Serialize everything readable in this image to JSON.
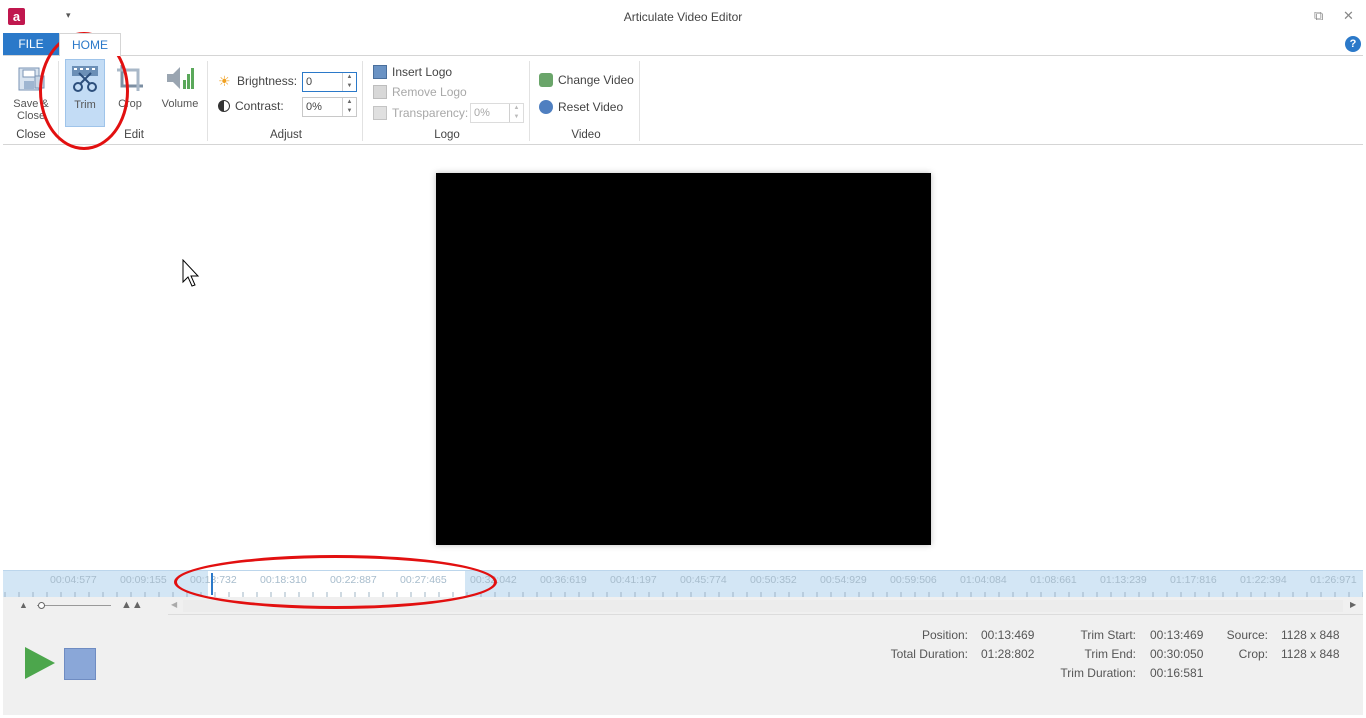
{
  "window": {
    "title": "Articulate Video Editor",
    "restore_glyph": "⧉",
    "close_glyph": "✕"
  },
  "app_icon_letter": "a",
  "qat_glyph": "▾",
  "ribbon": {
    "tabs": {
      "file": "FILE",
      "home": "HOME"
    },
    "help_glyph": "?",
    "close_group": {
      "label": "Close",
      "save_close_line1": "Save &",
      "save_close_line2": "Close"
    },
    "edit_group": {
      "label": "Edit",
      "trim": "Trim",
      "crop": "Crop",
      "volume": "Volume"
    },
    "adjust_group": {
      "label": "Adjust",
      "brightness_label": "Brightness:",
      "brightness_value": "0",
      "contrast_label": "Contrast:",
      "contrast_value": "0%"
    },
    "logo_group": {
      "label": "Logo",
      "insert_logo": "Insert Logo",
      "remove_logo": "Remove Logo",
      "transparency_label": "Transparency:",
      "transparency_value": "0%"
    },
    "video_group": {
      "label": "Video",
      "change_video": "Change Video",
      "reset_video": "Reset Video"
    }
  },
  "timeline": {
    "ticks": [
      "00:04:577",
      "00:09:155",
      "00:13:732",
      "00:18:310",
      "00:22:887",
      "00:27:465",
      "00:32:042",
      "00:36:619",
      "00:41:197",
      "00:45:774",
      "00:50:352",
      "00:54:929",
      "00:59:506",
      "01:04:084",
      "01:08:661",
      "01:13:239",
      "01:17:816",
      "01:22:394",
      "01:26:971"
    ],
    "visible_tick_labels": [
      "00:04:577",
      "00:09:155",
      "00:1",
      "3:732",
      "00:18:310",
      "00:22:887",
      "00:27:465",
      "00:3",
      "2:042",
      "00:36:619",
      "00:41:197",
      "00:45:774",
      "00:50:352",
      "00:54:929",
      "00:59:506",
      "01:04:084",
      "01:08:661",
      "01:13:239",
      "01:17:816",
      "01:22:394",
      "01:26:971"
    ]
  },
  "status": {
    "position_label": "Position:",
    "position_value": "00:13:469",
    "total_duration_label": "Total Duration:",
    "total_duration_value": "01:28:802",
    "trim_start_label": "Trim Start:",
    "trim_start_value": "00:13:469",
    "trim_end_label": "Trim End:",
    "trim_end_value": "00:30:050",
    "trim_duration_label": "Trim Duration:",
    "trim_duration_value": "00:16:581",
    "source_label": "Source:",
    "source_value": "1128 x 848",
    "crop_label": "Crop:",
    "crop_value": "1128 x 848"
  },
  "colors": {
    "accent": "#2b79c9",
    "play_green": "#4ca64c",
    "stop_blue": "#8aa7d8",
    "annotation_red": "#e21010",
    "timeline_bg": "#d3e6f5"
  }
}
